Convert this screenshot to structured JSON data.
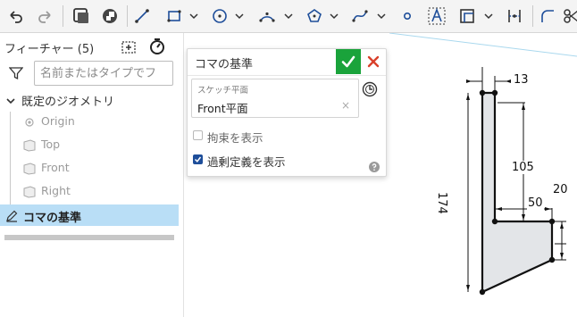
{
  "toolbar": {
    "items": [
      "undo-icon",
      "redo-icon",
      "sketch-view-icon",
      "feature-toggle-icon",
      "line-icon",
      "rectangle-icon",
      "circle-icon",
      "arc-icon",
      "polygon-icon",
      "spline-icon",
      "point-icon",
      "text-icon",
      "offset-icon",
      "midpoint-icon",
      "fillet-icon",
      "trim-icon"
    ]
  },
  "panel": {
    "title": "フィーチャー (5)",
    "filter_placeholder": "名前またはタイプでフ",
    "group_label": "既定のジオメトリ",
    "items": [
      {
        "label": "Origin"
      },
      {
        "label": "Top"
      },
      {
        "label": "Front"
      },
      {
        "label": "Right"
      }
    ],
    "feature_label": "コマの基準"
  },
  "dialog": {
    "title": "コマの基準",
    "sketch_plane_label": "スケッチ平面",
    "sketch_plane_value": "Front平面",
    "clear_symbol": "×",
    "show_constraints_label": "拘束を表示",
    "show_constraints_checked": false,
    "show_overdefined_label": "過剰定義を表示",
    "show_overdefined_checked": true,
    "ok_color": "#1aa33b",
    "cancel_color": "#d9402b"
  },
  "viewport": {
    "dimensions": {
      "top_width": "13",
      "height_upper": "105",
      "total_height": "174",
      "horizontal": "50",
      "right_height": "20"
    }
  },
  "colors": {
    "accent": "#1e4e9a",
    "selected_row": "#b9def6",
    "sketch_fill": "#e3e5e8"
  }
}
